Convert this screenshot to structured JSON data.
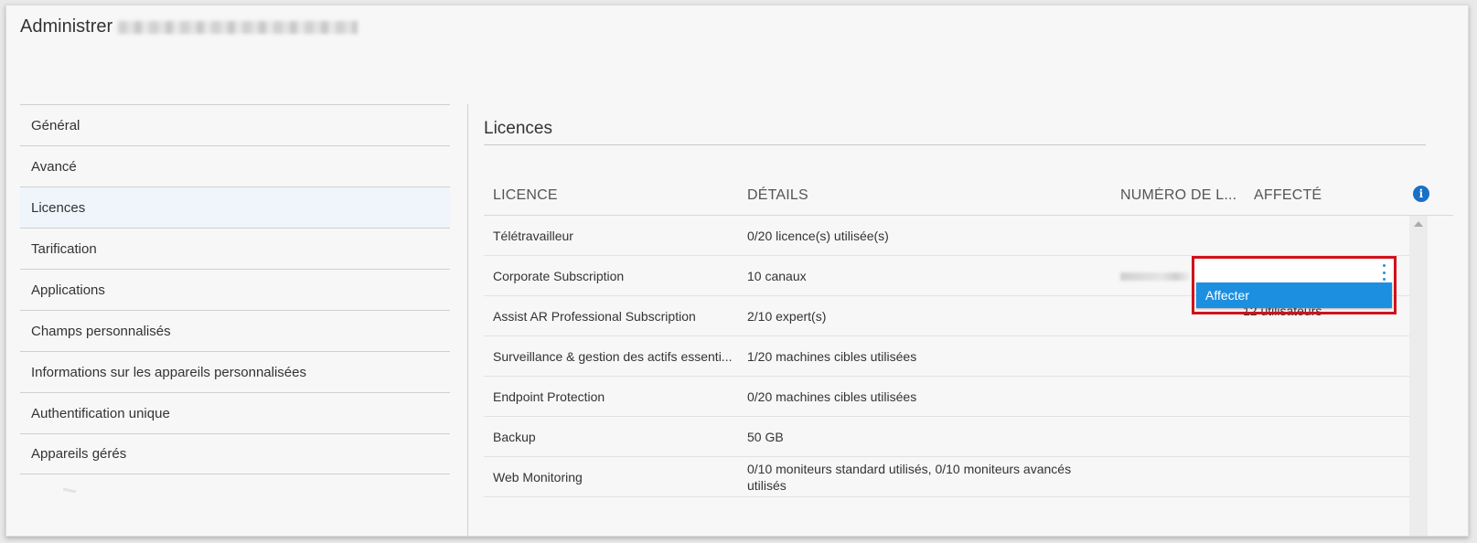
{
  "header": {
    "title": "Administrer"
  },
  "sidebar": {
    "items": [
      {
        "label": "Général"
      },
      {
        "label": "Avancé"
      },
      {
        "label": "Licences"
      },
      {
        "label": "Tarification"
      },
      {
        "label": "Applications"
      },
      {
        "label": "Champs personnalisés"
      },
      {
        "label": "Informations sur les appareils personnalisées"
      },
      {
        "label": "Authentification unique"
      },
      {
        "label": "Appareils gérés"
      }
    ],
    "active_index": 2
  },
  "main": {
    "section_title": "Licences",
    "table": {
      "headers": {
        "licence": "LICENCE",
        "details": "DÉTAILS",
        "numero": "NUMÉRO DE L...",
        "affecte": "AFFECTÉ"
      },
      "rows": [
        {
          "licence": "Télétravailleur",
          "details": "0/20 licence(s) utilisée(s)",
          "affecte": ""
        },
        {
          "licence": "Corporate Subscription",
          "details": "10 canaux",
          "affecte": "12 utilisateurs"
        },
        {
          "licence": "Assist AR Professional Subscription",
          "details": "2/10 expert(s)",
          "affecte": ""
        },
        {
          "licence": "Surveillance & gestion des actifs essenti...",
          "details": "1/20 machines cibles utilisées",
          "affecte": ""
        },
        {
          "licence": "Endpoint Protection",
          "details": "0/20 machines cibles utilisées",
          "affecte": ""
        },
        {
          "licence": "Backup",
          "details": "50 GB",
          "affecte": ""
        },
        {
          "licence": "Web Monitoring",
          "details": "0/10 moniteurs standard utilisés, 0/10 moniteurs avancés utilisés",
          "affecte": ""
        }
      ]
    },
    "context_menu": {
      "item_label": "Affecter"
    }
  },
  "icons": {
    "info": "info-icon",
    "kebab": "kebab-menu-icon",
    "scroll_up": "scroll-up-arrow-icon"
  },
  "colors": {
    "accent": "#1d8fe0",
    "highlight_border": "#d0121b",
    "info_icon": "#1a6fc7",
    "active_sidebar_bg": "#eff5fa"
  }
}
